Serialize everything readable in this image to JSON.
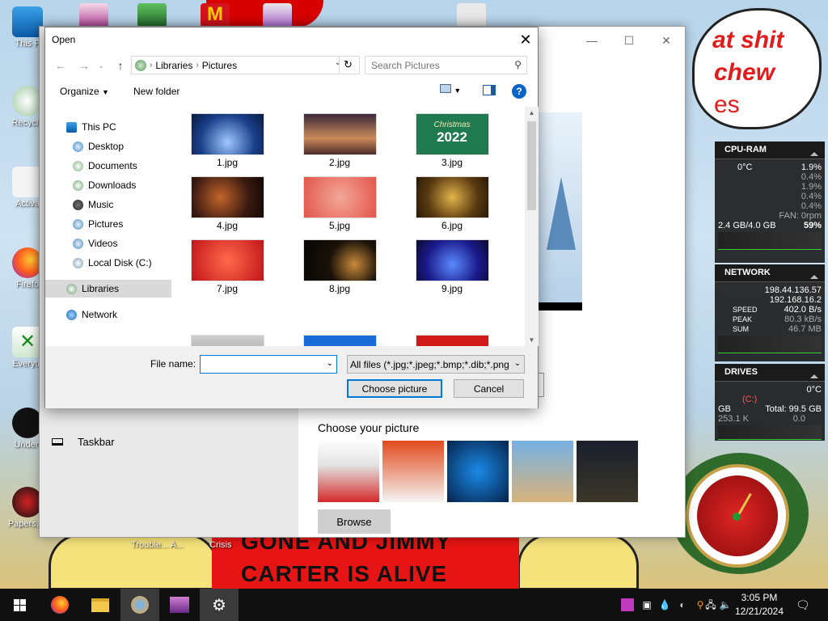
{
  "desktop": {
    "icons": [
      "This P",
      "Recycle",
      "Activa",
      "Firefo",
      "Everyth",
      "Undert",
      "Papers, P"
    ],
    "bubble_line1": "at shit",
    "bubble_line2": "chew",
    "bubble_line3": "es",
    "bottom_text_1": "GONE AND JIMMY",
    "bottom_text_2": "CARTER IS ALIVE",
    "bottom_labels": [
      "Trouble... A...",
      "Crisis"
    ]
  },
  "gadgets": {
    "cpu": {
      "title": "CPU-RAM",
      "temp": "0°C",
      "total": "1.9%",
      "cores": [
        "0.4%",
        "1.9%",
        "0.4%",
        "0.4%"
      ],
      "fan": "FAN: 0rpm",
      "ram": "2.4 GB/4.0 GB",
      "ram_pct": "59%"
    },
    "network": {
      "title": "NETWORK",
      "ip1": "198.44.136.57",
      "ip2": "192.168.16.2",
      "speed_label": "SPEED",
      "speed": "402.0 B/s",
      "peak_label": "PEAK",
      "peak": "80.3 kB/s",
      "sum_label": "SUM",
      "sum": "46.7 MB"
    },
    "drives": {
      "title": "DRIVES",
      "temp": "0°C",
      "drive": "(C:)",
      "total": "Total: 99.5 GB",
      "gb": "GB",
      "val": "0.0",
      "io": "253.1 K"
    }
  },
  "settings": {
    "taskbar_label": "Taskbar",
    "choose_picture_label": "Choose your picture",
    "browse_label": "Browse"
  },
  "dialog": {
    "title": "Open",
    "breadcrumb": [
      "Libraries",
      "Pictures"
    ],
    "search_placeholder": "Search Pictures",
    "organize_label": "Organize",
    "new_folder_label": "New folder",
    "nav": [
      {
        "label": "This PC"
      },
      {
        "label": "Desktop"
      },
      {
        "label": "Documents"
      },
      {
        "label": "Downloads"
      },
      {
        "label": "Music"
      },
      {
        "label": "Pictures"
      },
      {
        "label": "Videos"
      },
      {
        "label": "Local Disk (C:)"
      },
      {
        "label": "Libraries"
      },
      {
        "label": "Network"
      }
    ],
    "files": [
      {
        "name": "1.jpg"
      },
      {
        "name": "2.jpg"
      },
      {
        "name": "3.jpg"
      },
      {
        "name": "4.jpg"
      },
      {
        "name": "5.jpg"
      },
      {
        "name": "6.jpg"
      },
      {
        "name": "7.jpg"
      },
      {
        "name": "8.jpg"
      },
      {
        "name": "9.jpg"
      }
    ],
    "thumb_3_text": "Christmas",
    "thumb_3_year": "2022",
    "file_name_label": "File name:",
    "file_name_value": "",
    "filter_label": "All files (*.jpg;*.jpeg;*.bmp;*.dib;*.png",
    "choose_button": "Choose picture",
    "cancel_button": "Cancel"
  },
  "clock": {
    "time": "3:05 PM",
    "date": "12/21/2024"
  }
}
